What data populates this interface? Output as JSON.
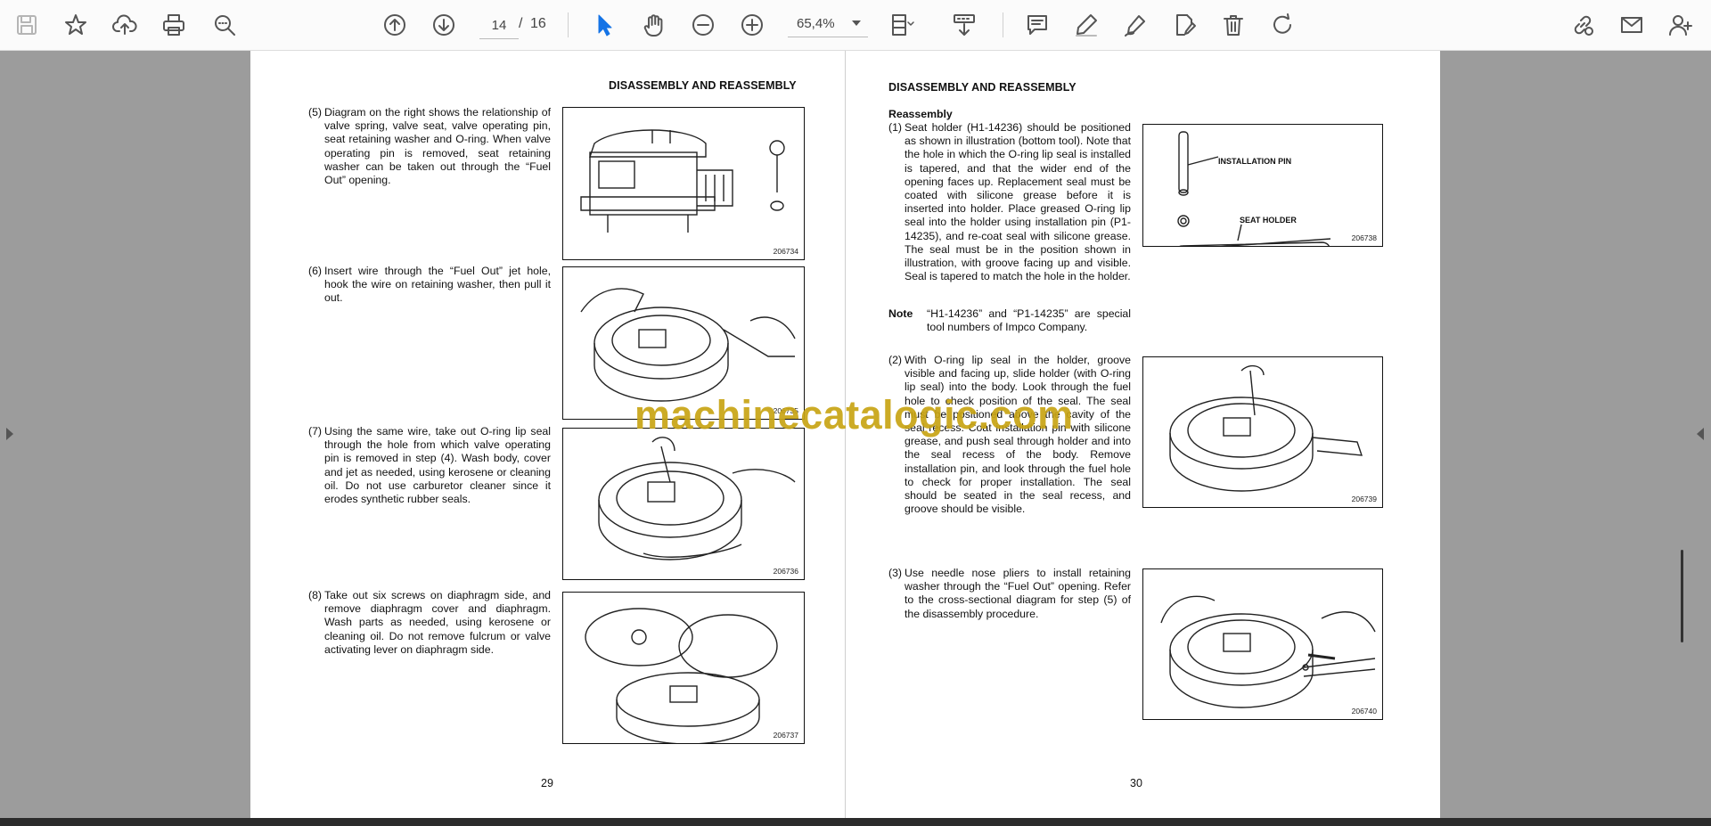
{
  "toolbar": {
    "page_current": "14",
    "page_separator": "/",
    "page_total": "16",
    "zoom": "65,4%"
  },
  "left_page": {
    "header": "DISASSEMBLY AND REASSEMBLY",
    "page_number": "29",
    "steps": [
      {
        "num": "(5)",
        "text": "Diagram on the right shows the relationship of valve spring, valve seat, valve operating pin, seat retaining washer and O-ring. When valve operating pin is removed, seat retaining washer can be taken out through the “Fuel Out” opening."
      },
      {
        "num": "(6)",
        "text": "Insert wire through the “Fuel Out” jet hole, hook the wire on retaining washer, then pull it out."
      },
      {
        "num": "(7)",
        "text": "Using the same wire, take out O-ring lip seal through the hole from which valve operating pin is removed in step (4). Wash body, cover and jet as needed, using kerosene or cleaning oil. Do not use carburetor cleaner since it erodes synthetic rubber seals."
      },
      {
        "num": "(8)",
        "text": "Take out six screws on diaphragm side, and remove diaphragm cover and diaphragm. Wash parts as needed, using kerosene or cleaning oil. Do not remove fulcrum or valve activating lever on diaphragm side."
      }
    ],
    "figures": [
      "206734",
      "206735",
      "206736",
      "206737"
    ]
  },
  "right_page": {
    "header": "DISASSEMBLY AND REASSEMBLY",
    "subheading": "Reassembly",
    "page_number": "30",
    "steps": [
      {
        "num": "(1)",
        "text": "Seat holder (H1-14236) should be positioned as shown in illustration (bottom tool). Note that the hole in which the O-ring lip seal is installed is tapered, and that the wider end of the opening faces up. Replacement seal must be coated with silicone grease before it is inserted into holder. Place greased O-ring lip seal into the holder using installation pin (P1-14235), and re-coat seal with silicone grease. The seal must be in the position shown in illustration, with groove facing up and visible. Seal is tapered to match the hole in the holder."
      },
      {
        "num": "(2)",
        "text": "With O-ring lip seal in the holder, groove visible and facing up, slide holder (with O-ring lip seal) into the body. Look through the fuel hole to check position of the seal. The seal must be positioned above the cavity of the seal recess. Coat installation pin with silicone grease, and push seal through holder and into the seal recess of the body. Remove installation pin, and look through the fuel hole to check for proper installation. The seal should be seated in the seal recess, and groove should be visible."
      },
      {
        "num": "(3)",
        "text": "Use needle nose pliers to install retaining washer through the “Fuel Out” opening. Refer to the cross-sectional diagram for step (5) of the disassembly procedure."
      }
    ],
    "note_label": "Note",
    "note_text": "“H1-14236” and “P1-14235” are special tool numbers of Impco Company.",
    "figure_labels": {
      "installation_pin": "INSTALLATION PIN",
      "seat_holder": "SEAT HOLDER"
    },
    "figures": [
      "206738",
      "206739",
      "206740"
    ]
  },
  "watermark": "machinecatalogic.com",
  "colors": {
    "accent": "#1473e6",
    "watermark": "#c8a414",
    "background": "#9c9c9c"
  }
}
